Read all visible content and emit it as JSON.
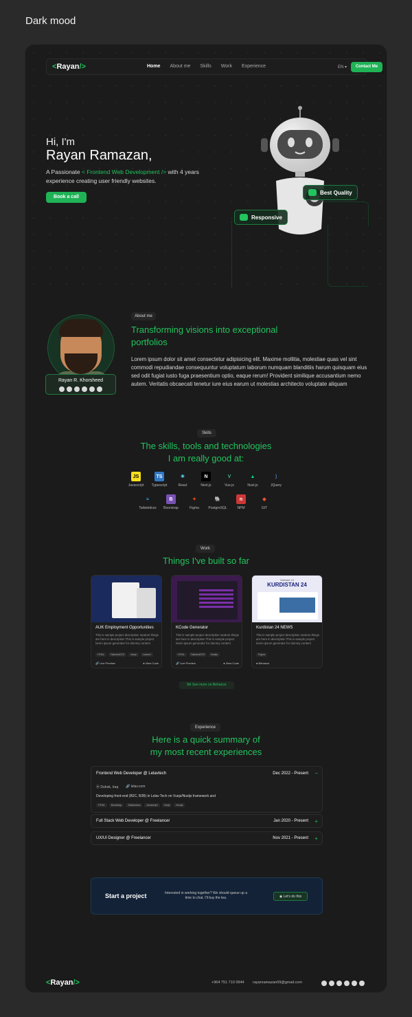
{
  "page": {
    "title": "Dark mood"
  },
  "colors": {
    "accent": "#22c55e",
    "background": "#1b1b1b",
    "page_bg": "#2a2a2a"
  },
  "nav": {
    "logo": {
      "open": "<",
      "text": "Rayan",
      "close": "/>"
    },
    "links": [
      "Home",
      "About me",
      "Skills",
      "Work",
      "Experience"
    ],
    "active": "Home",
    "lang": "EN",
    "contact": "Contact Me"
  },
  "hero": {
    "greeting": "Hi, I'm",
    "name": "Rayan Ramazan,",
    "desc_prefix": "A Passionate",
    "desc_highlight": "< Frontend Web Development />",
    "desc_suffix": "with 4 years experience creating user friendly websites.",
    "cta": "Book a call",
    "badges": [
      "Best Quality",
      "Responsive"
    ]
  },
  "about": {
    "pill": "About me",
    "title": "Transforming visions into exceptional portfolios",
    "text": "Lorem ipsum dolor sit amet consectetur adipisicing elit. Maxime mollitia, molestiae quas vel sint commodi repudiandae consequuntur voluptatum laborum numquam blanditiis harum quisquam eius sed odit fugiat iusto fuga praesentium optio, eaque rerum! Provident similique accusantium nemo autem. Veritatis obcaecati tenetur iure eius earum ut molestias architecto voluptate aliquam",
    "person_name": "Rayan R. Khorsheed",
    "socials": [
      "instagram-icon",
      "twitter-icon",
      "telegram-icon",
      "linkedin-icon",
      "behance-icon",
      "github-icon"
    ]
  },
  "skills": {
    "pill": "Skills",
    "title_line1": "The skills, tools and technologies",
    "title_line2": "I am really good at:",
    "row1": [
      {
        "label": "Javascript",
        "icon": "JS",
        "bg": "#f7df1e",
        "fg": "#000"
      },
      {
        "label": "Typescript",
        "icon": "TS",
        "bg": "#3178c6",
        "fg": "#fff"
      },
      {
        "label": "React",
        "icon": "⚛",
        "bg": "transparent",
        "fg": "#61dafb"
      },
      {
        "label": "Next.js",
        "icon": "N",
        "bg": "#000",
        "fg": "#fff"
      },
      {
        "label": "Vue.js",
        "icon": "V",
        "bg": "transparent",
        "fg": "#41b883"
      },
      {
        "label": "Nuxt.js",
        "icon": "▲",
        "bg": "transparent",
        "fg": "#00dc82"
      },
      {
        "label": "JQuery",
        "icon": ")",
        "bg": "transparent",
        "fg": "#4f7ac7"
      }
    ],
    "row2": [
      {
        "label": "Tailwindcss",
        "icon": "≈",
        "bg": "transparent",
        "fg": "#38bdf8"
      },
      {
        "label": "Boorstrap",
        "icon": "B",
        "bg": "#7952b3",
        "fg": "#fff"
      },
      {
        "label": "Figma",
        "icon": "✦",
        "bg": "transparent",
        "fg": "#f24e1e"
      },
      {
        "label": "PostgreSQL",
        "icon": "🐘",
        "bg": "transparent",
        "fg": "#6d9ccf"
      },
      {
        "label": "NPM",
        "icon": "n",
        "bg": "#cb3837",
        "fg": "#fff"
      },
      {
        "label": "GIT",
        "icon": "◆",
        "bg": "transparent",
        "fg": "#f05032"
      }
    ]
  },
  "work": {
    "pill": "Work",
    "title": "Things I've built so far",
    "projects": [
      {
        "title": "AUK Employment Opportunities",
        "desc": "This is sample project description random things are here in description This is sample project lorem ipsum generator for dummy content",
        "tags": [
          "HTML",
          "TailwindCSS",
          "Vuejs",
          "Laravel"
        ],
        "live": "Live Preview",
        "code": "View Code",
        "thumb": "#1b2a5c"
      },
      {
        "title": "KCode Generator",
        "desc": "This is sample project description random things are here in description This is sample project lorem ipsum generator for dummy content",
        "tags": [
          "HTML",
          "TailwindCSS",
          "Nuxtjs"
        ],
        "live": "Live Preview",
        "code": "View Code",
        "thumb": "#3b1b4d"
      },
      {
        "title": "Kurdistan 24 NEWS",
        "desc": "This is sample project description random things are here in description This is sample project lorem ipsum generator for dummy content",
        "tags": [
          "Figma"
        ],
        "live": "Behance",
        "code": "",
        "thumb": "#e9eaf5",
        "thumb_title": "KURDISTAN 24",
        "thumb_small": "Website UI"
      }
    ],
    "see_more": "See more on Behance"
  },
  "experience": {
    "pill": "Experience",
    "title_line1": "Here is a quick summary of",
    "title_line2": "my most recent experiences",
    "items": [
      {
        "title": "Frontend Web Developer @ Lelavtech",
        "date": "Dec 2022 - Present",
        "toggle": "−",
        "location": "Duhok, Iraq",
        "site": "lelav.com",
        "desc": "Developing front-end (B2C, B2B) in Lelav Tech on Vuejs/Nuxtjs framework and",
        "tags": [
          "HTML",
          "Bootstrap",
          "Tailwindcss",
          "Javascript",
          "Vuejs",
          "Nuxtjs"
        ]
      },
      {
        "title": "Full Stack Web Developer @ Freelancer",
        "date": "Jan 2020 - Present",
        "toggle": "+"
      },
      {
        "title": "UX/UI Designer @ Freelancer",
        "date": "Nov 2021 - Present",
        "toggle": "+"
      }
    ]
  },
  "cta": {
    "label": "Start a project",
    "message": "Interested in working together? We should queue up a time to chat. I'll buy the tea.",
    "button": "Let's do this"
  },
  "footer": {
    "phone": "+964 751 710 0944",
    "email": "rayanramazan09@gmail.com"
  }
}
